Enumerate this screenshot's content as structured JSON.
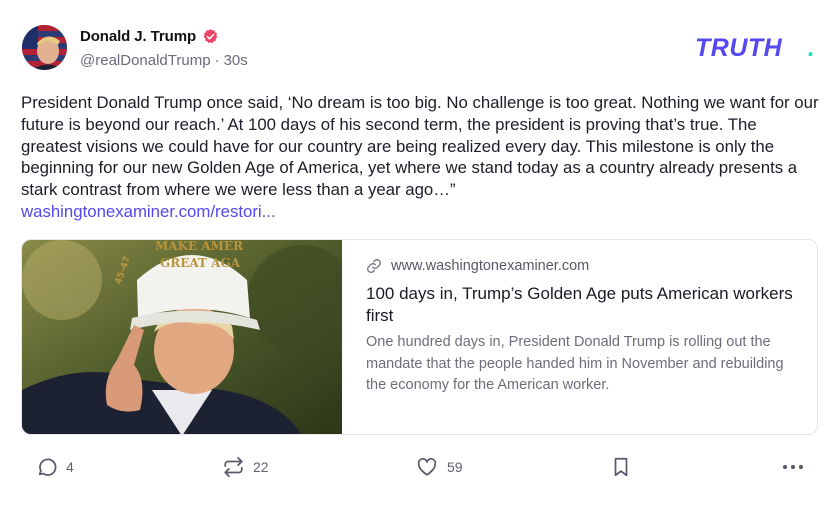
{
  "post": {
    "author": {
      "display_name": "Donald J. Trump",
      "handle": "@realDonaldTrump",
      "separator": "·",
      "timestamp": "30s",
      "verified": true
    },
    "brand": {
      "logo_text": "TRUTH",
      "logo_dot": ".",
      "accent_color": "#5448ee",
      "dot_color": "#17e8c1"
    },
    "text": "President Donald Trump once said, ‘No dream is too big. No challenge is too great. Nothing we want for our future is beyond our reach.’ At 100 days of his second term, the president is proving that’s true. The greatest visions we could have for our country are being realized every day. This milestone is only the beginning for our new Golden Age of America, yet where we stand today as a country already presents a stark contrast from where we were less than a year ago…”",
    "link_text": "washingtonexaminer.com/restori...",
    "card": {
      "image_icon": "news-photo",
      "cap_text_line1": "MAKE AMER",
      "cap_text_line2": "GREAT AGA",
      "cap_side_text": "45-47",
      "domain": "www.washingtonexaminer.com",
      "title": "100 days in, Trump’s Golden Age puts American workers first",
      "description": "One hundred days in, President Donald Trump is rolling out the mandate that the people handed him in November and rebuilding the economy for the American worker."
    },
    "actions": {
      "replies": "4",
      "retruths": "22",
      "likes": "59"
    }
  }
}
